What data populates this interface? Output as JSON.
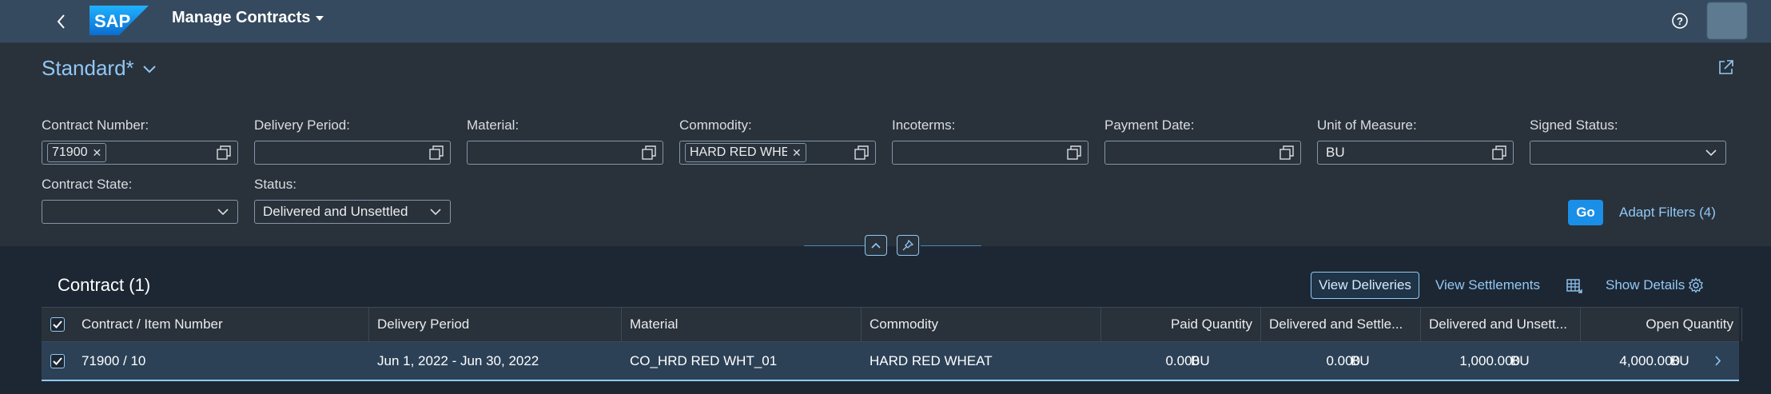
{
  "shell": {
    "app_title": "Manage Contracts",
    "logo_text": "SAP",
    "icons": {
      "back": "chevron-left-icon",
      "title_menu": "triangle-down-icon",
      "help": "help-icon"
    }
  },
  "filterbar": {
    "variant_name": "Standard*",
    "fields": [
      {
        "label": "Contract Number:",
        "token": "71900",
        "value": "",
        "type": "valuehelp"
      },
      {
        "label": "Delivery Period:",
        "token": "",
        "value": "",
        "type": "valuehelp"
      },
      {
        "label": "Material:",
        "token": "",
        "value": "",
        "type": "valuehelp"
      },
      {
        "label": "Commodity:",
        "token": "HARD RED WHEAT",
        "value": "",
        "type": "valuehelp"
      },
      {
        "label": "Incoterms:",
        "token": "",
        "value": "",
        "type": "valuehelp"
      },
      {
        "label": "Payment Date:",
        "token": "",
        "value": "",
        "type": "valuehelp"
      },
      {
        "label": "Unit of Measure:",
        "token": "",
        "value": "BU",
        "type": "valuehelp"
      },
      {
        "label": "Signed Status:",
        "token": "",
        "value": "",
        "type": "select"
      },
      {
        "label": "Contract State:",
        "token": "",
        "value": "",
        "type": "select"
      },
      {
        "label": "Status:",
        "token": "",
        "value": "Delivered and Unsettled",
        "type": "select"
      }
    ],
    "go_label": "Go",
    "adapt_filters_label": "Adapt Filters (4)"
  },
  "table": {
    "title": "Contract (1)",
    "toolbar": {
      "view_deliveries": "View Deliveries",
      "view_settlements": "View Settlements",
      "show_details": "Show Details"
    },
    "columns": [
      "Contract / Item Number",
      "Delivery Period",
      "Material",
      "Commodity",
      "Paid Quantity",
      "Delivered and Settle...",
      "Delivered and Unsett...",
      "Open Quantity"
    ],
    "rows": [
      {
        "contract_item": "71900 / 10",
        "delivery_period": "Jun 1, 2022 - Jun 30, 2022",
        "material": "CO_HRD RED WHT_01",
        "commodity": "HARD RED WHEAT",
        "paid_qty": "0.000",
        "paid_uom": "BU",
        "del_settled_qty": "0.000",
        "del_settled_uom": "BU",
        "del_unsettled_qty": "1,000.000",
        "del_unsettled_uom": "BU",
        "open_qty": "4,000.000",
        "open_uom": "BU",
        "selected": true
      }
    ]
  },
  "colors": {
    "shell_bg": "#354a5f",
    "filterbar_bg": "#29313a",
    "page_bg": "#1d2733",
    "accent": "#91c8f6",
    "emphasized_button": "#1a8fe8",
    "selected_row": "#2c4156"
  }
}
